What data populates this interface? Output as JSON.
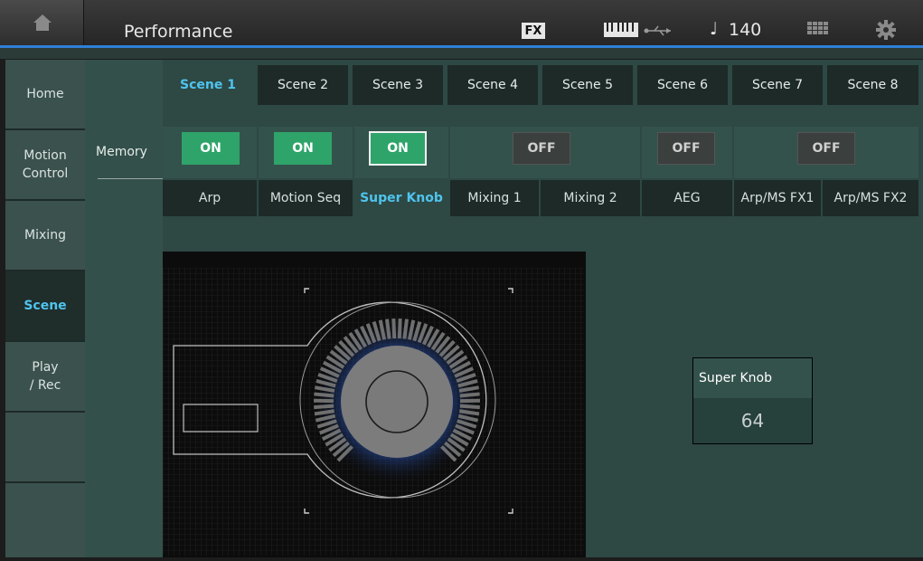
{
  "header": {
    "title": "Performance",
    "fx_label": "FX",
    "tempo_symbol": "♩",
    "tempo": "140",
    "icons": [
      "home-icon",
      "keyboard-icon",
      "usb-icon",
      "note-icon",
      "grid-icon",
      "gear-icon"
    ]
  },
  "sidebar": {
    "items": [
      {
        "label": "Home",
        "active": false
      },
      {
        "label": "Motion\nControl",
        "active": false
      },
      {
        "label": "Mixing",
        "active": false
      },
      {
        "label": "Scene",
        "active": true
      },
      {
        "label": "Play\n/ Rec",
        "active": false
      }
    ]
  },
  "memory_label": "Memory",
  "scenes": [
    {
      "label": "Scene 1",
      "active": true
    },
    {
      "label": "Scene 2",
      "active": false
    },
    {
      "label": "Scene 3",
      "active": false
    },
    {
      "label": "Scene 4",
      "active": false
    },
    {
      "label": "Scene 5",
      "active": false
    },
    {
      "label": "Scene 6",
      "active": false
    },
    {
      "label": "Scene 7",
      "active": false
    },
    {
      "label": "Scene 8",
      "active": false
    }
  ],
  "memory_buttons": [
    {
      "label": "ON",
      "state": "on"
    },
    {
      "label": "ON",
      "state": "on"
    },
    {
      "label": "ON",
      "state": "on-selected"
    },
    {
      "label": "OFF",
      "state": "off"
    },
    {
      "label": "OFF",
      "state": "off"
    },
    {
      "label": "OFF",
      "state": "off"
    }
  ],
  "param_tabs": [
    {
      "label": "Arp",
      "active": false
    },
    {
      "label": "Motion Seq",
      "active": false
    },
    {
      "label": "Super Knob",
      "active": true
    },
    {
      "label": "Mixing 1",
      "active": false
    },
    {
      "label": "Mixing 2",
      "active": false
    },
    {
      "label": "AEG",
      "active": false
    },
    {
      "label": "Arp/MS FX1",
      "active": false
    },
    {
      "label": "Arp/MS FX2",
      "active": false
    }
  ],
  "super_knob": {
    "label": "Super Knob",
    "value": "64"
  },
  "colors": {
    "accent": "#4fc4ee",
    "on_green": "#2fa46a",
    "topbar_line": "#2f7fd8"
  }
}
